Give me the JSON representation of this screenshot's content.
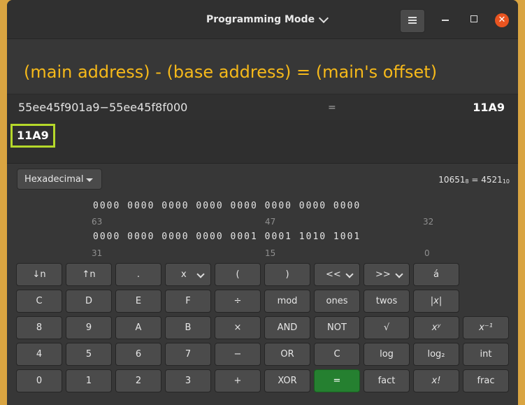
{
  "window": {
    "title": "Programming Mode"
  },
  "annotation": "(main address) - (base address) = (main's offset)",
  "history": {
    "expression": "55ee45f901a9−55ee45f8f000",
    "equals": "=",
    "result": "11A9"
  },
  "current_value": "11A9",
  "base_selector": "Hexadecimal",
  "conversion": {
    "octal": "10651",
    "octal_sub": "8",
    "eq": " = ",
    "decimal": "4521",
    "decimal_sub": "10"
  },
  "bits": {
    "row1": "0000 0000 0000 0000 0000 0000 0000 0000",
    "row1_labels": [
      "63",
      "47",
      "32"
    ],
    "row2": "0000 0000 0000 0000 0001 0001 1010 1001",
    "row2_labels": [
      "31",
      "15",
      "0"
    ]
  },
  "buttons": [
    [
      "↓n",
      "↑n",
      ".",
      "x",
      "(",
      ")",
      "<<",
      ">>",
      "á"
    ],
    [
      "C",
      "D",
      "E",
      "F",
      "÷",
      "mod",
      "ones",
      "twos",
      "|x|"
    ],
    [
      "8",
      "9",
      "A",
      "B",
      "×",
      "AND",
      "NOT",
      "√",
      "xʸ",
      "x⁻¹"
    ],
    [
      "4",
      "5",
      "6",
      "7",
      "−",
      "OR",
      "C",
      "log",
      "log₂",
      "int"
    ],
    [
      "0",
      "1",
      "2",
      "3",
      "+",
      "XOR",
      "=",
      "fact",
      "x!",
      "frac"
    ]
  ]
}
